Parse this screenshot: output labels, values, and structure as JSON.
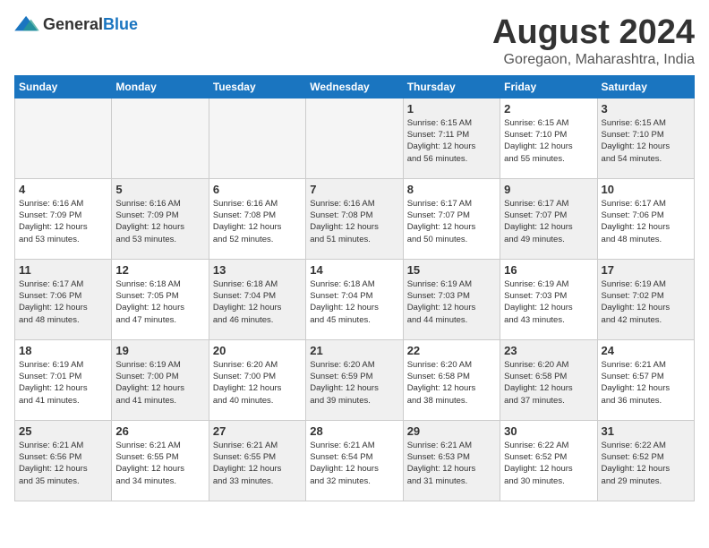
{
  "header": {
    "logo_general": "General",
    "logo_blue": "Blue",
    "month_year": "August 2024",
    "location": "Goregaon, Maharashtra, India"
  },
  "weekdays": [
    "Sunday",
    "Monday",
    "Tuesday",
    "Wednesday",
    "Thursday",
    "Friday",
    "Saturday"
  ],
  "weeks": [
    [
      {
        "day": "",
        "empty": true
      },
      {
        "day": "",
        "empty": true
      },
      {
        "day": "",
        "empty": true
      },
      {
        "day": "",
        "empty": true
      },
      {
        "day": "1",
        "sunrise": "6:15 AM",
        "sunset": "7:11 PM",
        "daylight": "12 hours and 56 minutes."
      },
      {
        "day": "2",
        "sunrise": "6:15 AM",
        "sunset": "7:10 PM",
        "daylight": "12 hours and 55 minutes."
      },
      {
        "day": "3",
        "sunrise": "6:15 AM",
        "sunset": "7:10 PM",
        "daylight": "12 hours and 54 minutes."
      }
    ],
    [
      {
        "day": "4",
        "sunrise": "6:16 AM",
        "sunset": "7:09 PM",
        "daylight": "12 hours and 53 minutes."
      },
      {
        "day": "5",
        "sunrise": "6:16 AM",
        "sunset": "7:09 PM",
        "daylight": "12 hours and 53 minutes."
      },
      {
        "day": "6",
        "sunrise": "6:16 AM",
        "sunset": "7:08 PM",
        "daylight": "12 hours and 52 minutes."
      },
      {
        "day": "7",
        "sunrise": "6:16 AM",
        "sunset": "7:08 PM",
        "daylight": "12 hours and 51 minutes."
      },
      {
        "day": "8",
        "sunrise": "6:17 AM",
        "sunset": "7:07 PM",
        "daylight": "12 hours and 50 minutes."
      },
      {
        "day": "9",
        "sunrise": "6:17 AM",
        "sunset": "7:07 PM",
        "daylight": "12 hours and 49 minutes."
      },
      {
        "day": "10",
        "sunrise": "6:17 AM",
        "sunset": "7:06 PM",
        "daylight": "12 hours and 48 minutes."
      }
    ],
    [
      {
        "day": "11",
        "sunrise": "6:17 AM",
        "sunset": "7:06 PM",
        "daylight": "12 hours and 48 minutes."
      },
      {
        "day": "12",
        "sunrise": "6:18 AM",
        "sunset": "7:05 PM",
        "daylight": "12 hours and 47 minutes."
      },
      {
        "day": "13",
        "sunrise": "6:18 AM",
        "sunset": "7:04 PM",
        "daylight": "12 hours and 46 minutes."
      },
      {
        "day": "14",
        "sunrise": "6:18 AM",
        "sunset": "7:04 PM",
        "daylight": "12 hours and 45 minutes."
      },
      {
        "day": "15",
        "sunrise": "6:19 AM",
        "sunset": "7:03 PM",
        "daylight": "12 hours and 44 minutes."
      },
      {
        "day": "16",
        "sunrise": "6:19 AM",
        "sunset": "7:03 PM",
        "daylight": "12 hours and 43 minutes."
      },
      {
        "day": "17",
        "sunrise": "6:19 AM",
        "sunset": "7:02 PM",
        "daylight": "12 hours and 42 minutes."
      }
    ],
    [
      {
        "day": "18",
        "sunrise": "6:19 AM",
        "sunset": "7:01 PM",
        "daylight": "12 hours and 41 minutes."
      },
      {
        "day": "19",
        "sunrise": "6:19 AM",
        "sunset": "7:00 PM",
        "daylight": "12 hours and 41 minutes."
      },
      {
        "day": "20",
        "sunrise": "6:20 AM",
        "sunset": "7:00 PM",
        "daylight": "12 hours and 40 minutes."
      },
      {
        "day": "21",
        "sunrise": "6:20 AM",
        "sunset": "6:59 PM",
        "daylight": "12 hours and 39 minutes."
      },
      {
        "day": "22",
        "sunrise": "6:20 AM",
        "sunset": "6:58 PM",
        "daylight": "12 hours and 38 minutes."
      },
      {
        "day": "23",
        "sunrise": "6:20 AM",
        "sunset": "6:58 PM",
        "daylight": "12 hours and 37 minutes."
      },
      {
        "day": "24",
        "sunrise": "6:21 AM",
        "sunset": "6:57 PM",
        "daylight": "12 hours and 36 minutes."
      }
    ],
    [
      {
        "day": "25",
        "sunrise": "6:21 AM",
        "sunset": "6:56 PM",
        "daylight": "12 hours and 35 minutes."
      },
      {
        "day": "26",
        "sunrise": "6:21 AM",
        "sunset": "6:55 PM",
        "daylight": "12 hours and 34 minutes."
      },
      {
        "day": "27",
        "sunrise": "6:21 AM",
        "sunset": "6:55 PM",
        "daylight": "12 hours and 33 minutes."
      },
      {
        "day": "28",
        "sunrise": "6:21 AM",
        "sunset": "6:54 PM",
        "daylight": "12 hours and 32 minutes."
      },
      {
        "day": "29",
        "sunrise": "6:21 AM",
        "sunset": "6:53 PM",
        "daylight": "12 hours and 31 minutes."
      },
      {
        "day": "30",
        "sunrise": "6:22 AM",
        "sunset": "6:52 PM",
        "daylight": "12 hours and 30 minutes."
      },
      {
        "day": "31",
        "sunrise": "6:22 AM",
        "sunset": "6:52 PM",
        "daylight": "12 hours and 29 minutes."
      }
    ]
  ]
}
